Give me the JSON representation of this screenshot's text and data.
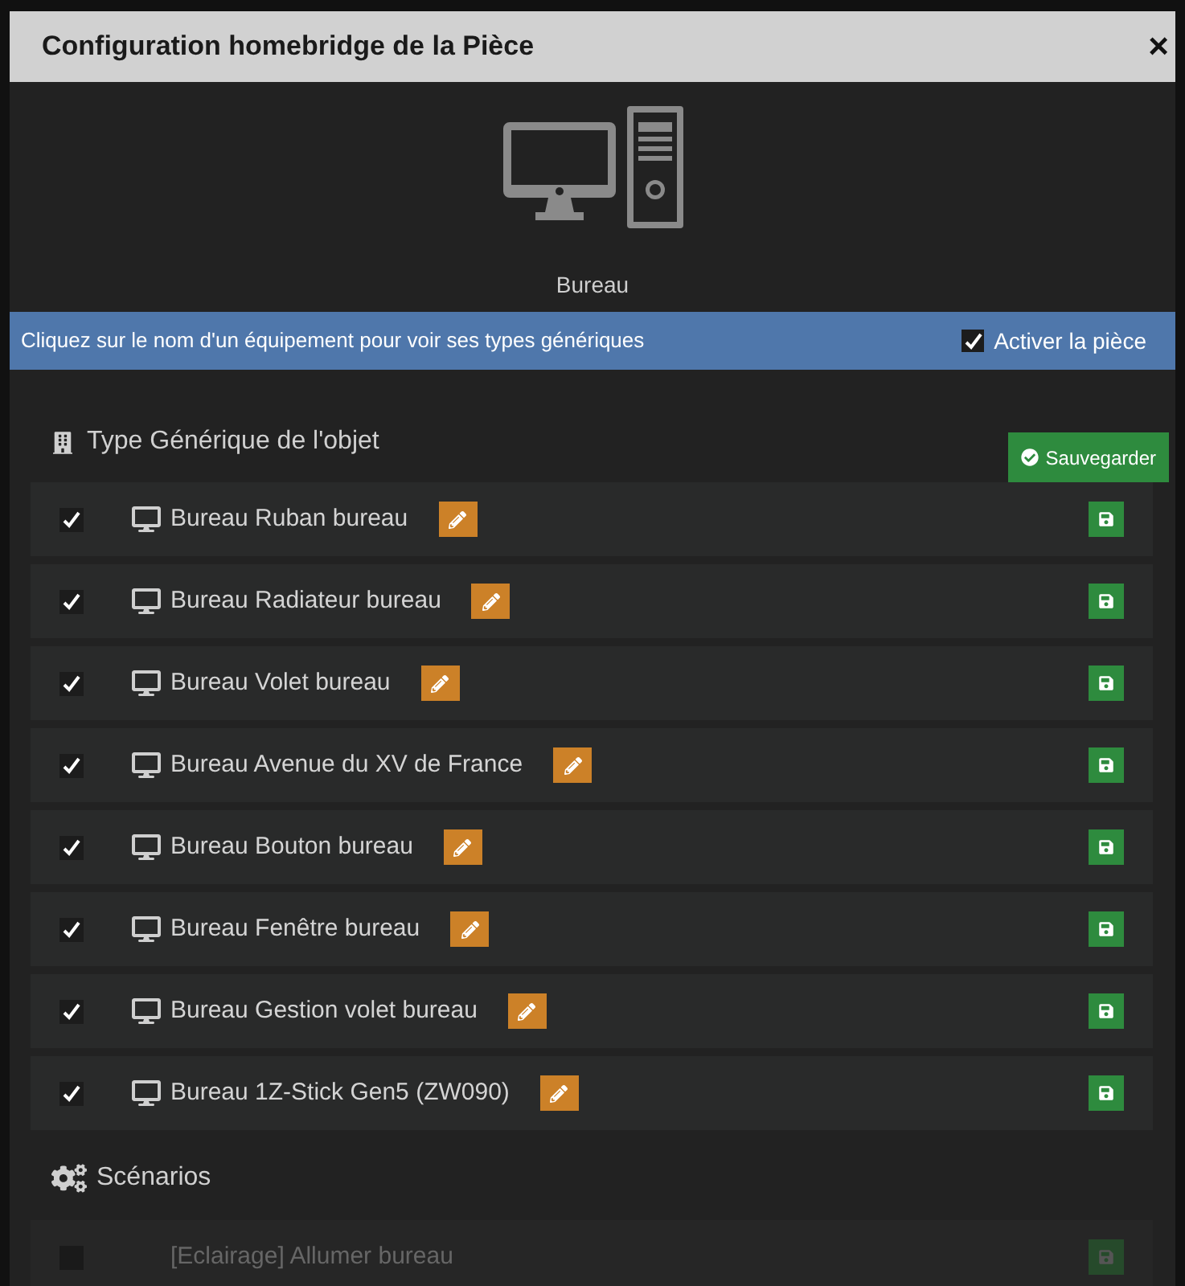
{
  "dialog": {
    "title": "Configuration homebridge de la Pièce",
    "close": "×"
  },
  "room": {
    "name": "Bureau"
  },
  "info_bar": {
    "text": "Cliquez sur le nom d'un équipement pour voir ses types génériques",
    "activate": {
      "label": "Activer la pièce",
      "checked": true
    }
  },
  "equipment_section": {
    "title": "Type Générique de l'objet",
    "save_label": "Sauvegarder",
    "items": [
      {
        "name": "Bureau Ruban bureau",
        "checked": true,
        "disabled": false
      },
      {
        "name": "Bureau Radiateur bureau",
        "checked": true,
        "disabled": false
      },
      {
        "name": "Bureau Volet bureau",
        "checked": true,
        "disabled": false
      },
      {
        "name": "Bureau Avenue du XV de France",
        "checked": true,
        "disabled": false
      },
      {
        "name": "Bureau Bouton bureau",
        "checked": true,
        "disabled": false
      },
      {
        "name": "Bureau Fenêtre bureau",
        "checked": true,
        "disabled": false
      },
      {
        "name": "Bureau Gestion volet bureau",
        "checked": true,
        "disabled": false
      },
      {
        "name": "Bureau 1Z-Stick Gen5 (ZW090)",
        "checked": true,
        "disabled": false
      }
    ]
  },
  "scenario_section": {
    "title": "Scénarios",
    "items": [
      {
        "name": "[Eclairage] Allumer bureau",
        "checked": false,
        "disabled": true
      }
    ]
  }
}
